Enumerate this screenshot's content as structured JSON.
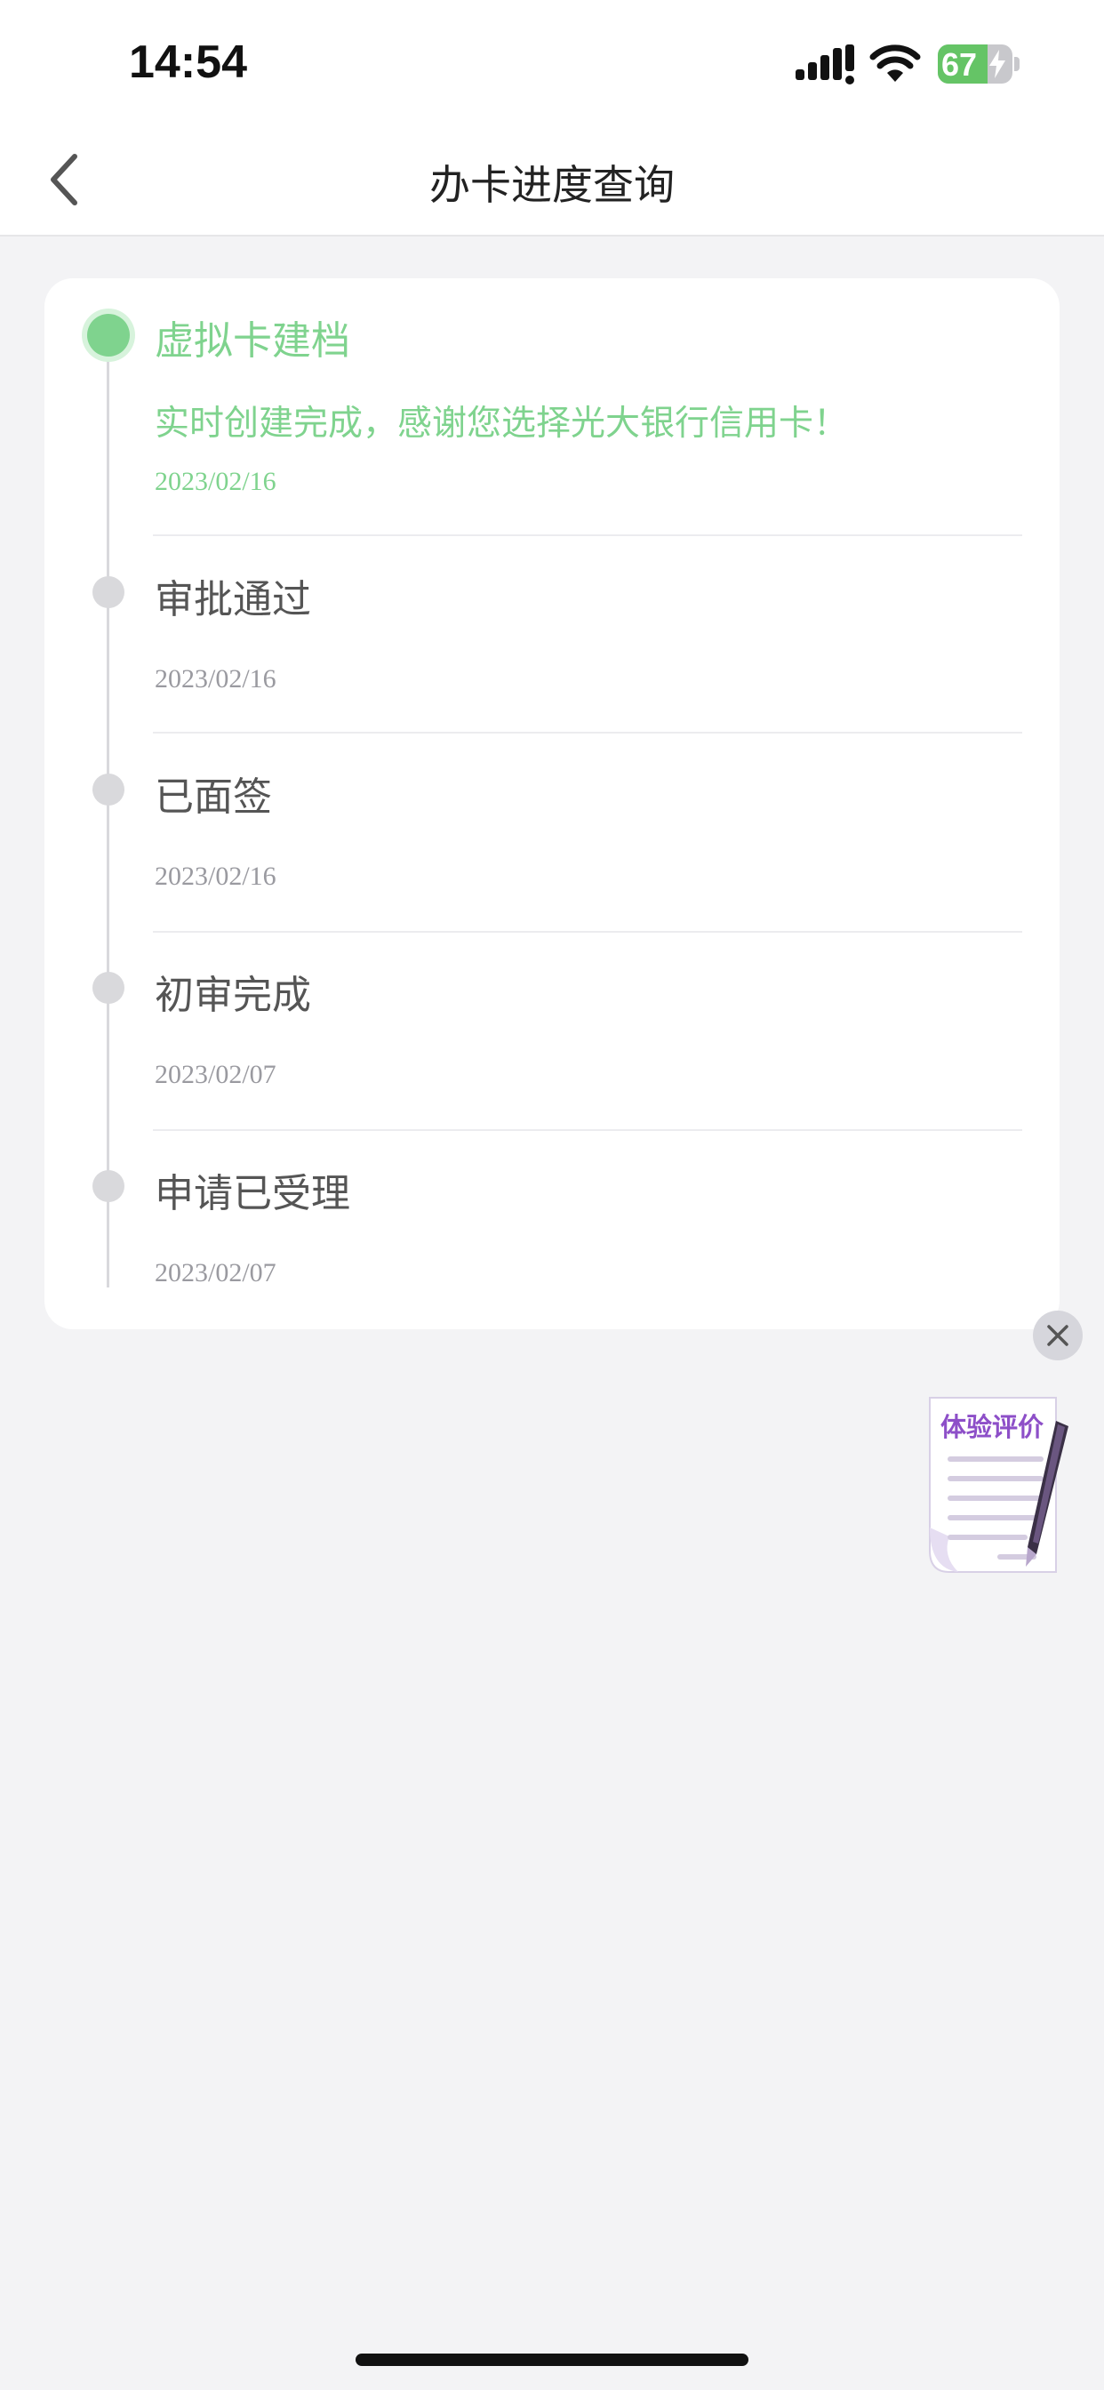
{
  "status_bar": {
    "time": "14:54",
    "battery_percent": 67,
    "battery_text": "67",
    "battery_charging": true,
    "icons": [
      "signal-icon",
      "wifi-icon",
      "battery-icon",
      "charging-bolt-icon"
    ]
  },
  "nav": {
    "title": "办卡进度查询",
    "back_icon": "chevron-left-icon"
  },
  "colors": {
    "active": "#7fd38e",
    "inactive_dot": "#d9d9dc",
    "feedback_purple": "#8d4fc8"
  },
  "timeline": {
    "steps": [
      {
        "title": "虚拟卡建档",
        "desc": "实时创建完成，感谢您选择光大银行信用卡！",
        "date": "2023/02/16",
        "active": true
      },
      {
        "title": "审批通过",
        "date": "2023/02/16",
        "active": false
      },
      {
        "title": "已面签",
        "date": "2023/02/16",
        "active": false
      },
      {
        "title": "初审完成",
        "date": "2023/02/07",
        "active": false
      },
      {
        "title": "申请已受理",
        "date": "2023/02/07",
        "active": false
      }
    ]
  },
  "feedback": {
    "label": "体验评价",
    "close_icon": "close-icon",
    "icon": "document-pen-icon"
  }
}
